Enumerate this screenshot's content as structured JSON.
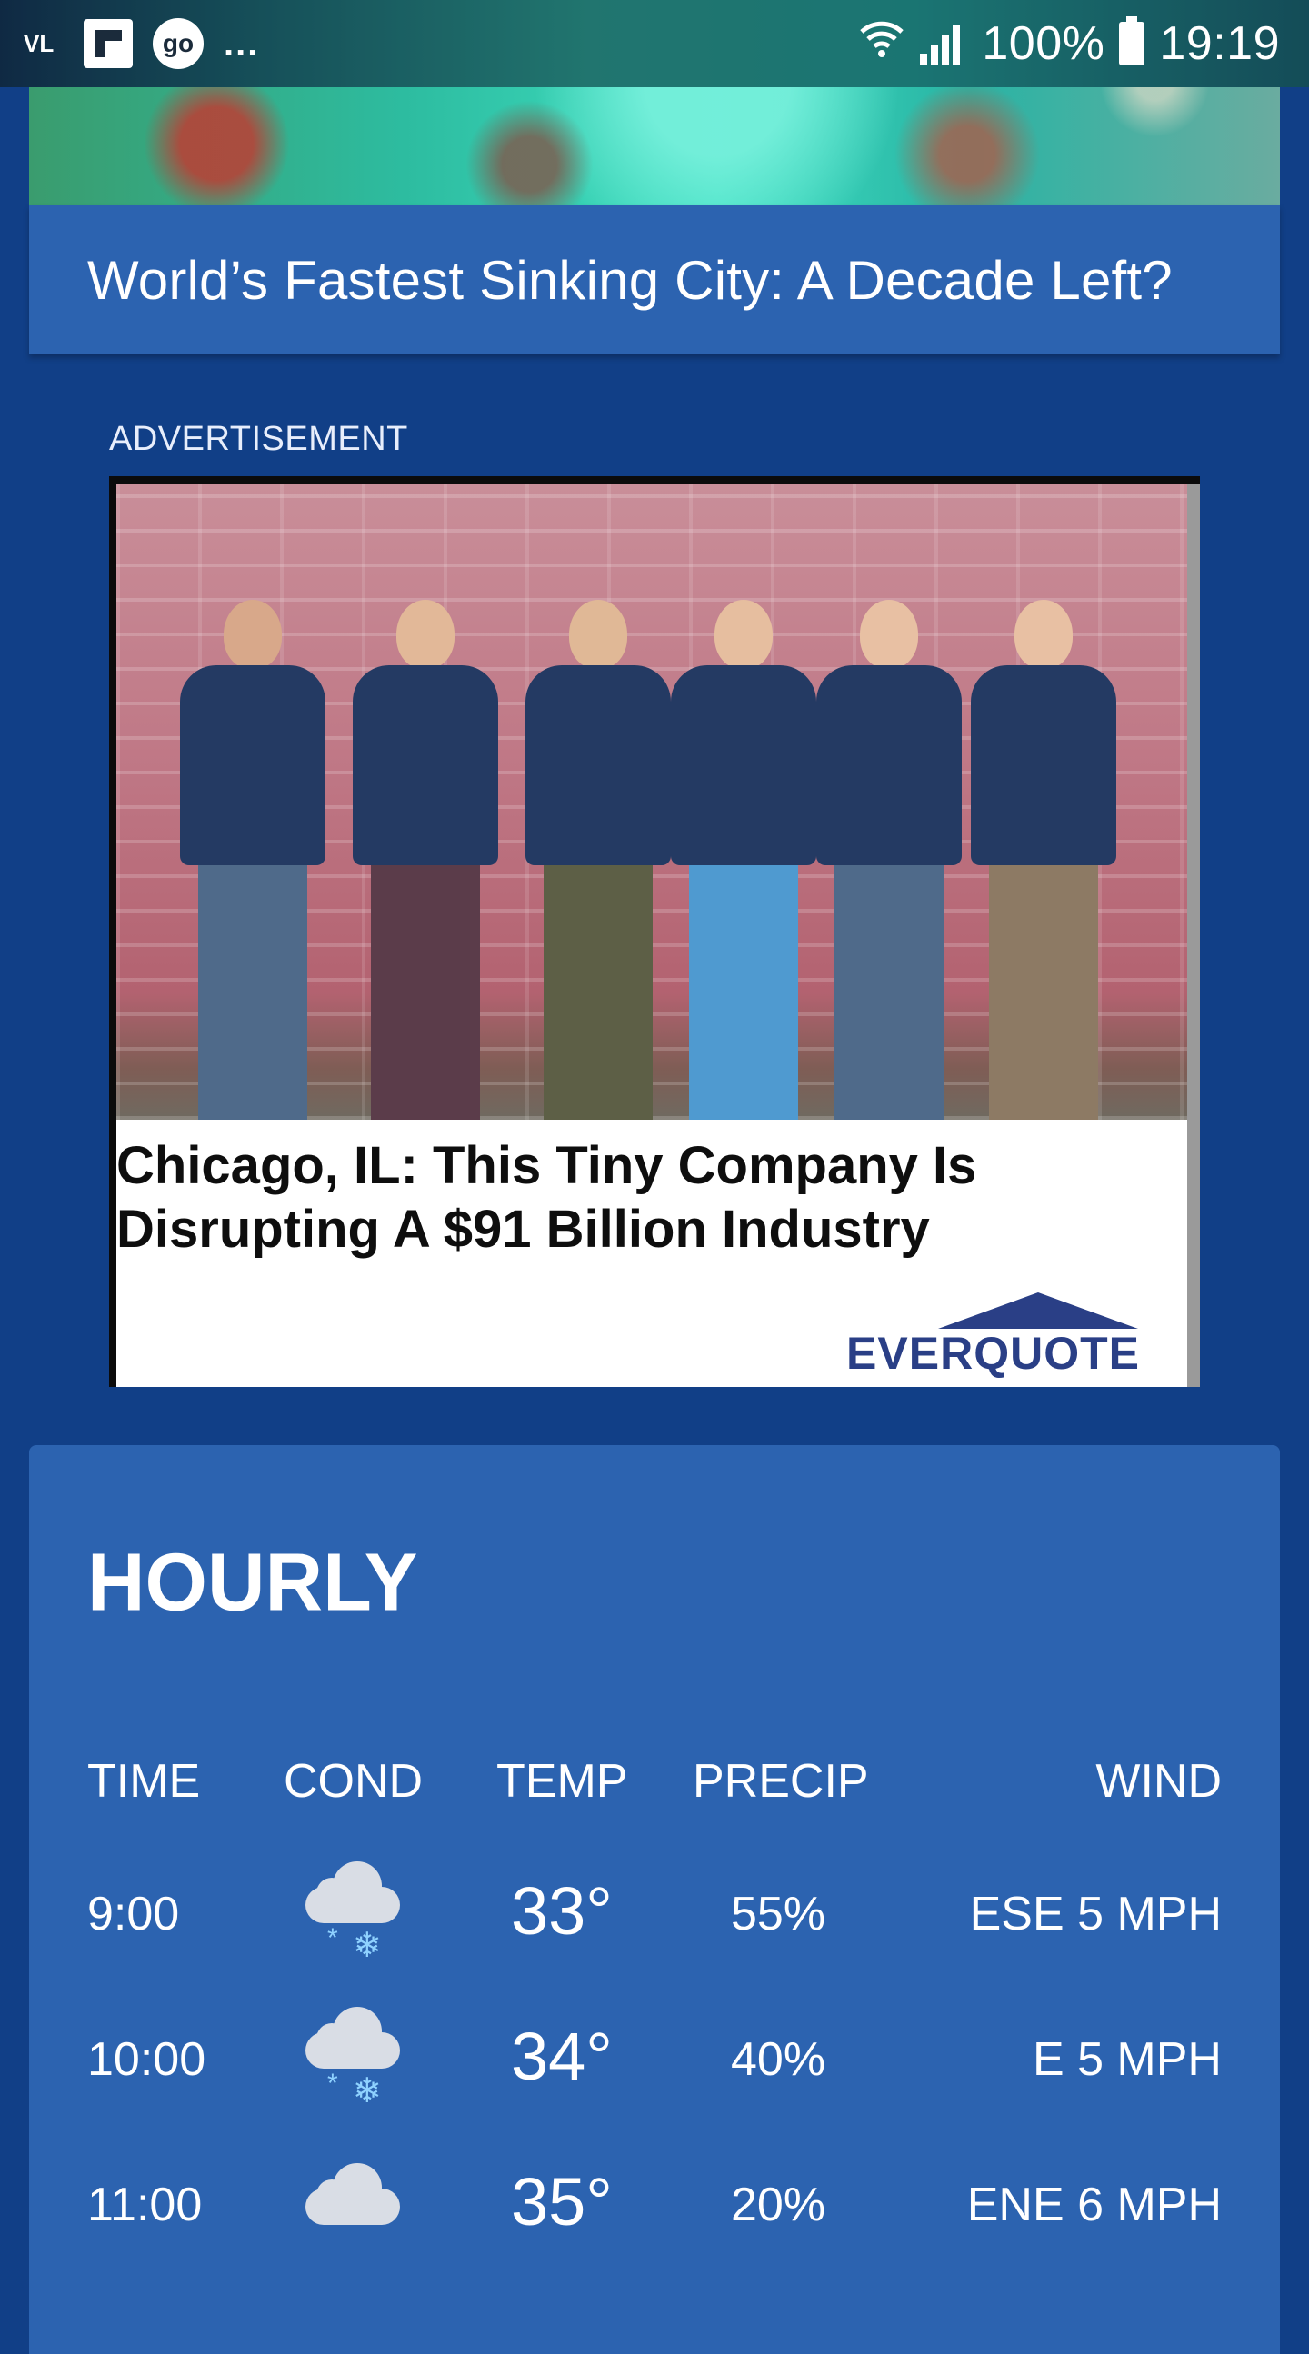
{
  "status_bar": {
    "left_icons": [
      "vl-icon",
      "flipboard-icon",
      "go-icon"
    ],
    "vl_label": "VL",
    "go_label": "go",
    "more": "...",
    "battery": "100%",
    "time": "19:19"
  },
  "top_article": {
    "headline": "World’s Fastest Sinking City: A Decade Left?"
  },
  "advertisement": {
    "label": "ADVERTISEMENT",
    "title_line1": "Chicago, IL: This Tiny Company Is",
    "title_line2": "Disrupting A $91 Billion Industry",
    "brand": "EVERQUOTE"
  },
  "hourly": {
    "title": "HOURLY",
    "headers": {
      "time": "TIME",
      "cond": "COND",
      "temp": "TEMP",
      "precip": "PRECIP",
      "wind": "WIND"
    },
    "rows": [
      {
        "time": "9:00",
        "cond_icon": "snow-cloud-icon",
        "temp": "33°",
        "precip": "55%",
        "wind": "ESE 5 MPH"
      },
      {
        "time": "10:00",
        "cond_icon": "snow-cloud-icon",
        "temp": "34°",
        "precip": "40%",
        "wind": "E 5 MPH"
      },
      {
        "time": "11:00",
        "cond_icon": "cloud-icon",
        "temp": "35°",
        "precip": "20%",
        "wind": "ENE 6 MPH"
      }
    ]
  },
  "colors": {
    "page_background": "#113f87",
    "card_blue": "#2c63b0",
    "snow_blue": "#8fd2ff",
    "brand_navy": "#2a3f86"
  }
}
